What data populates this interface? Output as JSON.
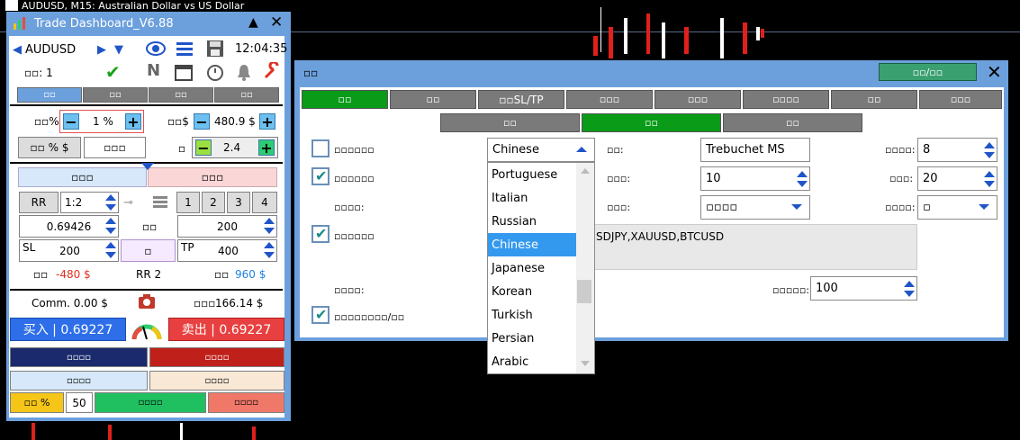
{
  "chart": {
    "title": "AUDUSD, M15:  Australian Dollar vs US Dollar"
  },
  "dashboard": {
    "title": "Trade Dashboard_V6.88",
    "symbol": "AUDUSD",
    "time": "12:04:35",
    "counter_label": "▫▫: 1",
    "tabs": [
      "▫▫",
      "▫▫",
      "▫▫",
      "▫▫"
    ],
    "risk_label": "▫▫%",
    "risk_value": "1 %",
    "money_label": "▫▫$",
    "money_value": "480.9 $",
    "pct_dollar_btn": "▫▫ % $",
    "blank_btn": "▫▫▫",
    "lot_label": "▫",
    "lot_value": "2.4",
    "buy_tab": "▫▫▫",
    "sell_tab": "▫▫▫",
    "rr_btn": "RR",
    "rr_value": "1:2",
    "num_btns": [
      "1",
      "2",
      "3",
      "4"
    ],
    "entry_price": "0.69426",
    "entry_label": "▫▫",
    "points_value": "200",
    "sl_label": "SL",
    "sl_value": "200",
    "mid_btn": "▫",
    "tp_label": "TP",
    "tp_value": "400",
    "loss_label": "▫▫",
    "loss_value": "-480 $",
    "rr_text": "RR 2",
    "profit_label": "▫▫",
    "profit_value": "960 $",
    "commission": "Comm. 0.00 $",
    "balance_label": "▫▫▫",
    "balance_value": "166.14 $",
    "buy_btn": "买入 | 0.69227",
    "sell_btn": "卖出 | 0.69227",
    "row1": [
      "▫▫▫▫",
      "▫▫▫▫"
    ],
    "row2": [
      "▫▫▫▫",
      "▫▫▫▫"
    ],
    "pct_btn": "▫▫ %",
    "pct_value": "50",
    "close_btns": [
      "▫▫▫▫",
      "▫▫▫▫"
    ],
    "colors": {
      "buy": "#2e6ee8",
      "sell": "#e84040",
      "accent": "#6ca0dc"
    }
  },
  "settings": {
    "title": "▫▫",
    "top_button": "▫▫/▫▫",
    "tabs": [
      "▫▫",
      "▫▫",
      "▫▫SL/TP",
      "▫▫▫",
      "▫▫▫",
      "▫▫▫▫",
      "▫▫",
      "▫▫▫"
    ],
    "subtabs": [
      "▫▫",
      "▫▫",
      "▫▫"
    ],
    "rows": [
      {
        "label": "▫▫▫▫▫▫",
        "checked": false
      },
      {
        "label": "▫▫▫▫▫▫",
        "checked": true
      },
      {
        "label": "▫▫▫▫:"
      },
      {
        "label": "▫▫▫▫▫▫",
        "checked": true
      },
      {
        "label": "▫▫▫▫:"
      },
      {
        "label": "▫▫▫▫▫▫▫▫/▫▫",
        "checked": true
      }
    ],
    "language_value": "Chinese",
    "font_label": "▫▫:",
    "font_value": "Trebuchet MS",
    "size_label": "▫▫▫▫:",
    "size_value": "8",
    "field_label2": "▫▫▫:",
    "field_value2": "10",
    "field_label3": "▫▫▫:",
    "field_value3": "20",
    "field_label4": "▫▫▫:",
    "dropdown4": "▫▫▫▫",
    "field_label5": "▫▫▫▫:",
    "dropdown5": "▫",
    "symbols_text": "SDJPY,XAUUSD,BTCUSD",
    "field_label6": "▫▫▫▫▫:",
    "field_value6": "100",
    "languages": [
      "Portuguese",
      "Italian",
      "Russian",
      "Chinese",
      "Japanese",
      "Korean",
      "Turkish",
      "Persian",
      "Arabic"
    ],
    "selected_language": "Chinese"
  }
}
